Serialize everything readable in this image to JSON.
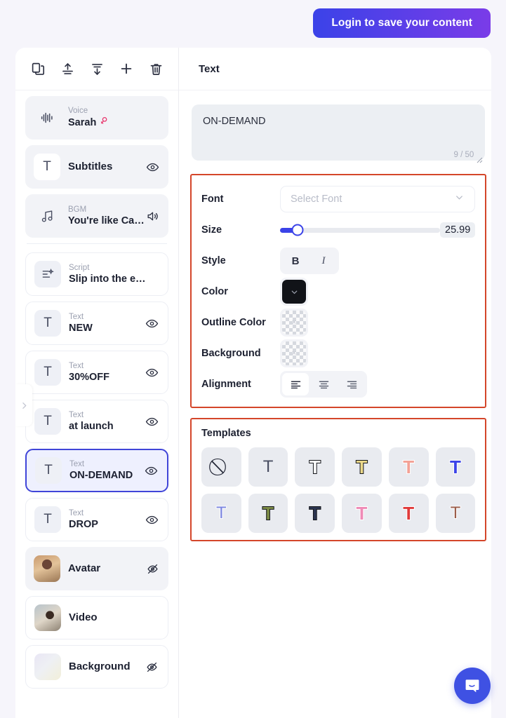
{
  "topbar": {
    "login_label": "Login to save your content",
    "gradient_from": "#3b42e8",
    "gradient_to": "#7a3ce8"
  },
  "left_toolbar": {
    "icons": [
      {
        "name": "duplicate-icon",
        "label": "Duplicate"
      },
      {
        "name": "bring-forward-icon",
        "label": "Bring forward"
      },
      {
        "name": "send-backward-icon",
        "label": "Send backward"
      },
      {
        "name": "add-icon",
        "label": "Add"
      },
      {
        "name": "delete-icon",
        "label": "Delete"
      }
    ]
  },
  "layers": {
    "group_a": [
      {
        "kind": "Voice",
        "name": "Sarah",
        "icon": "waveform-icon",
        "trailing": "gender-female-icon",
        "style": "grey"
      },
      {
        "kind": "",
        "name": "Subtitles",
        "icon": "text-icon",
        "trailing": "eye-icon",
        "style": "grey",
        "single": true
      },
      {
        "kind": "BGM",
        "name": "You're like Ca…",
        "icon": "music-note-icon",
        "trailing": "volume-icon",
        "style": "grey"
      }
    ],
    "group_b": [
      {
        "kind": "Script",
        "name": "Slip into the e…",
        "icon": "script-icon",
        "trailing": "",
        "style": "white"
      },
      {
        "kind": "Text",
        "name": "NEW",
        "icon": "text-icon",
        "trailing": "eye-icon",
        "style": "white"
      },
      {
        "kind": "Text",
        "name": "30%OFF",
        "icon": "text-icon",
        "trailing": "eye-icon",
        "style": "white"
      },
      {
        "kind": "Text",
        "name": "at launch",
        "icon": "text-icon",
        "trailing": "eye-icon",
        "style": "white"
      },
      {
        "kind": "Text",
        "name": "ON-DEMAND",
        "icon": "text-icon",
        "trailing": "eye-icon",
        "style": "sel"
      },
      {
        "kind": "Text",
        "name": "DROP",
        "icon": "text-icon",
        "trailing": "eye-icon",
        "style": "white"
      },
      {
        "kind": "",
        "name": "Avatar",
        "icon": "avatar-thumb",
        "trailing": "eye-off-icon",
        "style": "grey",
        "single": true
      },
      {
        "kind": "",
        "name": "Video",
        "icon": "video-thumb",
        "trailing": "",
        "style": "white",
        "single": true
      },
      {
        "kind": "",
        "name": "Background",
        "icon": "background-thumb",
        "trailing": "eye-off-icon",
        "style": "white",
        "single": true
      }
    ]
  },
  "panel": {
    "title": "Text",
    "textarea": {
      "value": "ON-DEMAND",
      "counter": "9 / 50"
    },
    "font": {
      "label": "Font",
      "placeholder": "Select Font",
      "value": ""
    },
    "size": {
      "label": "Size",
      "value": "25.99",
      "percent": 11,
      "min": 0,
      "max": 200,
      "accent": "#3b43e8"
    },
    "style": {
      "label": "Style",
      "bold_label": "B",
      "italic_label": "I",
      "bold_active": true,
      "italic_active": false
    },
    "color": {
      "label": "Color",
      "value": "#111318"
    },
    "outline_color": {
      "label": "Outline Color",
      "value": "transparent"
    },
    "background": {
      "label": "Background",
      "value": "transparent"
    },
    "alignment": {
      "label": "Alignment",
      "options": [
        "left",
        "center",
        "right"
      ],
      "selected": "left"
    },
    "highlight_color": "#d4462a"
  },
  "templates": {
    "title": "Templates",
    "items": [
      {
        "name": "template-none",
        "glyph": "⃠",
        "fill": "#1c2030",
        "stroke": "none",
        "thin": true
      },
      {
        "name": "template-plain",
        "glyph": "T",
        "fill": "#4a4f63",
        "stroke": "none",
        "thin": true
      },
      {
        "name": "template-black-outline",
        "glyph": "T",
        "fill": "#ffffff",
        "stroke": "#111318",
        "thin": false
      },
      {
        "name": "template-yellow",
        "glyph": "T",
        "fill": "#ecd98a",
        "stroke": "#111318",
        "thin": false
      },
      {
        "name": "template-coral",
        "glyph": "T",
        "fill": "#f3a195",
        "stroke": "#ffffff",
        "thin": false
      },
      {
        "name": "template-blue",
        "glyph": "T",
        "fill": "#3b43e8",
        "stroke": "#ffffff",
        "thin": false
      },
      {
        "name": "template-light-blue",
        "glyph": "T",
        "fill": "#7b85e0",
        "stroke": "#ffffff",
        "thin": true
      },
      {
        "name": "template-olive",
        "glyph": "T",
        "fill": "#7d8c46",
        "stroke": "#111318",
        "thin": false
      },
      {
        "name": "template-navy",
        "glyph": "T",
        "fill": "#2c3550",
        "stroke": "#111318",
        "thin": false
      },
      {
        "name": "template-pink",
        "glyph": "T",
        "fill": "#ef8ab6",
        "stroke": "#ffffff",
        "thin": false
      },
      {
        "name": "template-red",
        "glyph": "T",
        "fill": "#e03a3a",
        "stroke": "#ffffff",
        "thin": false
      },
      {
        "name": "template-brown",
        "glyph": "T",
        "fill": "#9a5c4a",
        "stroke": "#ffffff",
        "thin": true
      }
    ]
  },
  "chat": {
    "name": "chat-bubble",
    "label": "Open chat"
  },
  "collapse": {
    "label": "Expand panel"
  }
}
